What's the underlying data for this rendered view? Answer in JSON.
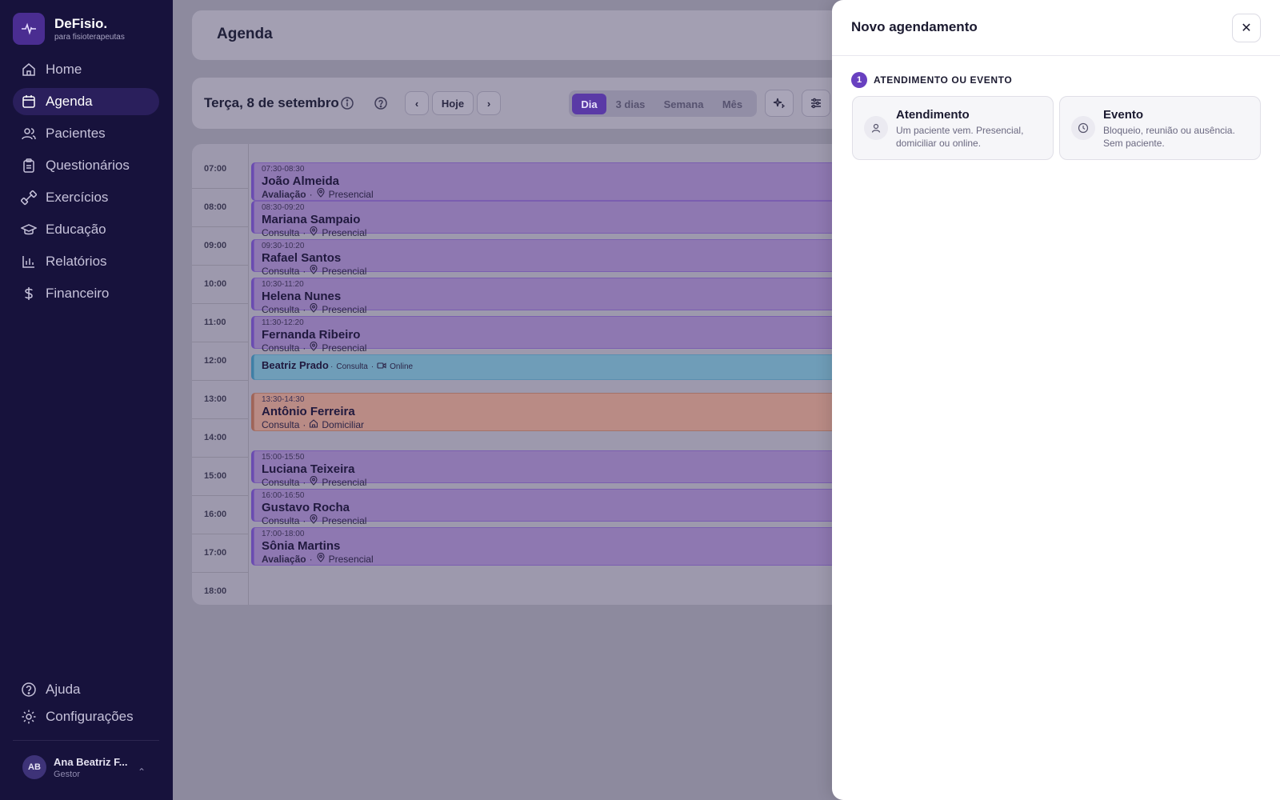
{
  "sidebar": {
    "brand_name": "DeFisio.",
    "brand_sub": "para fisioterapeutas",
    "items": [
      {
        "label": "Home",
        "icon": "home-icon"
      },
      {
        "label": "Agenda",
        "icon": "calendar-icon",
        "active": true
      },
      {
        "label": "Pacientes",
        "icon": "users-icon"
      },
      {
        "label": "Questionários",
        "icon": "clipboard-icon"
      },
      {
        "label": "Exercícios",
        "icon": "dumbbell-icon"
      },
      {
        "label": "Educação",
        "icon": "graduation-cap-icon"
      },
      {
        "label": "Relatórios",
        "icon": "bar-chart-icon"
      },
      {
        "label": "Financeiro",
        "icon": "dollar-icon"
      }
    ],
    "bottom": [
      {
        "label": "Ajuda",
        "icon": "help-circle-icon"
      },
      {
        "label": "Configurações",
        "icon": "gear-icon"
      }
    ],
    "user": {
      "initials": "AB",
      "name": "Ana Beatriz F...",
      "role": "Gestor"
    }
  },
  "header": {
    "title": "Agenda"
  },
  "toolbar": {
    "date": "Terça, 8 de setembro",
    "today": "Hoje",
    "views": [
      "Dia",
      "3 dias",
      "Semana",
      "Mês"
    ],
    "active_view": "Dia"
  },
  "calendar": {
    "hours": [
      "07:00",
      "08:00",
      "09:00",
      "10:00",
      "11:00",
      "12:00",
      "13:00",
      "14:00",
      "15:00",
      "16:00",
      "17:00",
      "18:00"
    ],
    "appointments": [
      {
        "time": "07:30-08:30",
        "name": "João Almeida",
        "type": "Avaliação",
        "mode": "Presencial"
      },
      {
        "time": "08:30-09:20",
        "name": "Mariana Sampaio",
        "type": "Consulta",
        "mode": "Presencial"
      },
      {
        "time": "09:30-10:20",
        "name": "Rafael Santos",
        "type": "Consulta",
        "mode": "Presencial"
      },
      {
        "time": "10:30-11:20",
        "name": "Helena Nunes",
        "type": "Consulta",
        "mode": "Presencial"
      },
      {
        "time": "11:30-12:20",
        "name": "Fernanda Ribeiro",
        "type": "Consulta",
        "mode": "Presencial"
      },
      {
        "time": "",
        "name": "Beatriz Prado",
        "type": "Consulta",
        "mode": "Online"
      },
      {
        "time": "13:30-14:30",
        "name": "Antônio Ferreira",
        "type": "Consulta",
        "mode": "Domiciliar"
      },
      {
        "time": "15:00-15:50",
        "name": "Luciana Teixeira",
        "type": "Consulta",
        "mode": "Presencial"
      },
      {
        "time": "16:00-16:50",
        "name": "Gustavo Rocha",
        "type": "Consulta",
        "mode": "Presencial"
      },
      {
        "time": "17:00-18:00",
        "name": "Sônia Martins",
        "type": "Avaliação",
        "mode": "Presencial"
      }
    ]
  },
  "panel": {
    "title": "Novo agendamento",
    "step_number": "1",
    "step_label": "ATENDIMENTO OU EVENTO",
    "options": [
      {
        "title": "Atendimento",
        "desc": "Um paciente vem. Presencial, domiciliar ou online.",
        "icon": "user-icon"
      },
      {
        "title": "Evento",
        "desc": "Bloqueio, reunião ou ausência. Sem paciente.",
        "icon": "clock-icon"
      }
    ]
  },
  "colors": {
    "sidebar_bg": "#17123c",
    "accent": "#6840c0",
    "presencial": "#8e78b1",
    "online": "#6f9db8",
    "domiciliar": "#b98b85"
  }
}
